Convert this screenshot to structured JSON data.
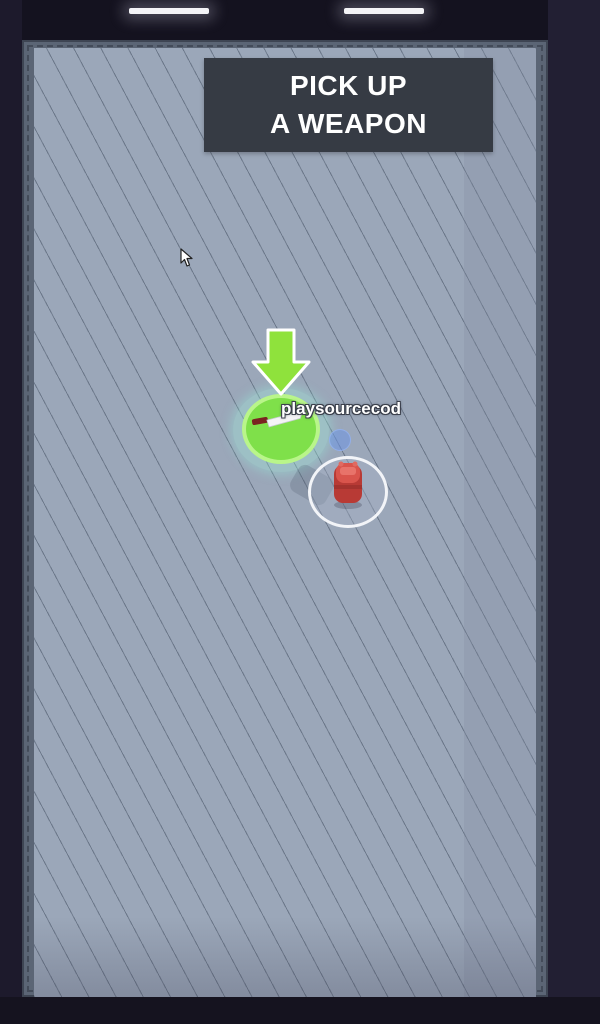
{
  "hud": {
    "objective_line1": "PICK UP",
    "objective_line2": "A WEAPON"
  },
  "player": {
    "name": "playsourcecod",
    "color": "#c8463f"
  },
  "pickup": {
    "item": "knife-icon",
    "ring_color": "#7fe04a",
    "arrow_color": "#8fe23c"
  },
  "colors": {
    "floor": "#9ba7b9",
    "banner": "#363b44",
    "walls": "#1d1a2c"
  }
}
